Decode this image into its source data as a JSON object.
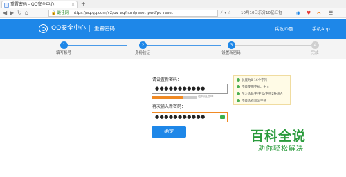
{
  "browser": {
    "tab_title": "重置密码 - QQ安全中心",
    "tab_close": "×",
    "newtab": "+",
    "nav": {
      "back": "◀",
      "forward": "▶",
      "refresh": "↻",
      "home": "⌂"
    },
    "secure_label": "最佳网",
    "url": "https://aq.qq.com/v2/uv_aq/html/reset_pwd/pc_reset",
    "url_actions": "⚡ ▾  ☆",
    "news": "10月10日乐分10亿红包",
    "extensions": [
      "◉",
      "♥",
      "✂",
      "☰"
    ]
  },
  "header": {
    "brand": "QQ安全中心",
    "page_name": "重置密码",
    "links": [
      "兵攻ID题",
      "手机App"
    ]
  },
  "steps": [
    {
      "num": "1",
      "label": "填写帐号",
      "active": true
    },
    {
      "num": "2",
      "label": "身份验证",
      "active": true
    },
    {
      "num": "3",
      "label": "设置新密码",
      "active": true
    },
    {
      "num": "4",
      "label": "完成",
      "active": false
    }
  ],
  "form": {
    "new_label": "请设置新密码：",
    "new_value": "●●●●●●●●●●●",
    "strength_text": "密码强度中",
    "confirm_label": "再次输入新密码：",
    "confirm_value": "●●●●●●●●●●●",
    "submit_label": "确定",
    "colors": {
      "accent": "#1e87e8",
      "strength_fill": "#f08a24",
      "strength_empty": "#cccccc"
    }
  },
  "tips": [
    "长度为8-16个字符",
    "不能使用空格、中文",
    "至少含数字/字母/字符2种组合",
    "不能含有非法字符"
  ],
  "watermark": {
    "title": "百科全说",
    "subtitle": "助你轻松解决"
  }
}
